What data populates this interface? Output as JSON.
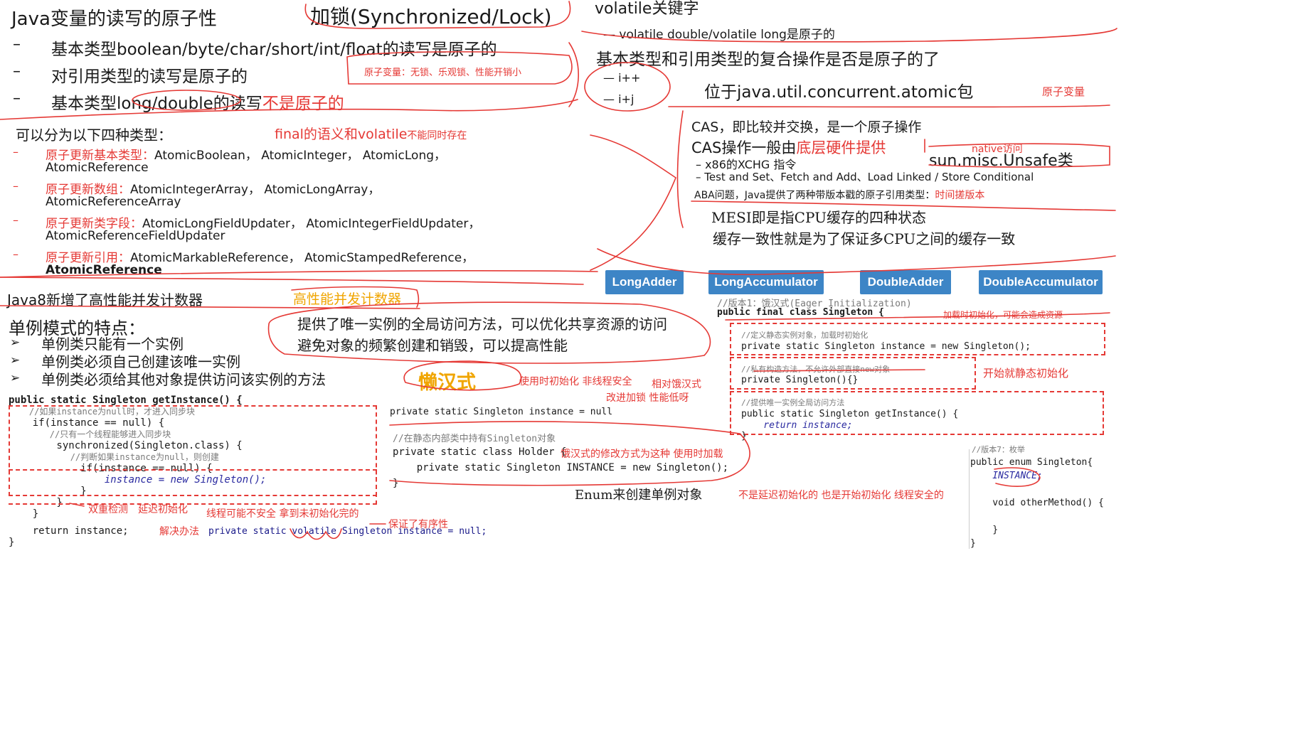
{
  "colors": {
    "red": "#e53935",
    "orange": "#f0a500",
    "badge": "#3d85c6"
  },
  "atomic_rw": {
    "title": "Java变量的读写的原子性",
    "items": [
      "基本类型boolean/byte/char/short/int/float的读写是原子的",
      "对引用类型的读写是原子的",
      "基本类型long/double的读写"
    ],
    "not_atomic": "不是原子的",
    "dash": "–"
  },
  "lock": {
    "title": "加锁(Synchronized/Lock)",
    "note": "原子变量：无锁、乐观锁、性能开销小"
  },
  "volatile_sec": {
    "title": "volatile关键字",
    "line1": "— volatile double/volatile long是原子的",
    "line2": "基本类型和引用类型的复合操作是否是原子的了",
    "ops": [
      "— i++",
      "— i+j"
    ],
    "pkg": "位于java.util.concurrent.atomic包",
    "pkg_note": "原子变量"
  },
  "four_types": {
    "title": "可以分为以下四种类型：",
    "note": "final的语义和volatile",
    "note2": "不能同时存在",
    "rows": [
      {
        "label": "原子更新基本类型：",
        "text": "AtomicBoolean， AtomicInteger， AtomicLong，",
        "line2": "AtomicReference"
      },
      {
        "label": "原子更新数组：",
        "text": "AtomicIntegerArray， AtomicLongArray，",
        "line2": "AtomicReferenceArray"
      },
      {
        "label": "原子更新类字段：",
        "text": "AtomicLongFieldUpdater， AtomicIntegerFieldUpdater，",
        "line2": "AtomicReferenceFieldUpdater"
      },
      {
        "label": "原子更新引用：",
        "text": "AtomicMarkableReference， AtomicStampedReference，",
        "line2": "AtomicReference"
      }
    ]
  },
  "cas": {
    "line1": "CAS，即比较并交换，是一个原子操作",
    "line2a": "CAS操作一般由",
    "line2b": "底层硬件提供",
    "native_note": "native访问",
    "unsafe": "sun.misc.Unsafe类",
    "sub1": "– x86的XCHG 指令",
    "sub2": "– Test and Set、Fetch and Add、Load Linked / Store Conditional",
    "aba": "ABA问题，Java提供了两种带版本戳的原子引用类型：",
    "aba_note": "时间搓版本"
  },
  "mesi": {
    "line1": "MESI即是指CPU缓存的四种状态",
    "line2": "缓存一致性就是为了保证多CPU之间的缓存一致"
  },
  "adders": [
    "LongAdder",
    "LongAccumulator",
    "DoubleAdder",
    "DoubleAccumulator"
  ],
  "java8": {
    "title": "Java8新增了高性能并发计数器",
    "note": "高性能并发计数器"
  },
  "singleton": {
    "title": "单例模式的特点：",
    "items": [
      "单例类只能有一个实例",
      "单例类必须自己创建该唯一实例",
      "单例类必须给其他对象提供访问该实例的方法"
    ],
    "benefit1": "提供了唯一实例的全局访问方法，可以优化共享资源的访问",
    "benefit2": "避免对象的频繁创建和销毁，可以提高性能",
    "lazy": "懒汉式",
    "lazy_note": "使用时初始化 非线程安全",
    "lazy_note2": "相对饿汉式",
    "lazy_note3": "改进加锁 性能低呀"
  },
  "dcl": {
    "lines": [
      "public static Singleton getInstance() {",
      "    //如果instance为null时，才进入同步块",
      "    if(instance == null) {",
      "        //只有一个线程能够进入同步块",
      "        synchronized(Singleton.class) {",
      "            //判断如果instance为null，则创建",
      "            if(instance == null) {",
      "                instance = new Singleton();",
      "            }",
      "        }",
      "    }",
      "    return instance;",
      "}"
    ],
    "note1": "双重检测　延迟初始化",
    "note2": "线程可能不安全 拿到未初始化完的",
    "fix_label": "解决办法",
    "fix_code": "private static volatile Singleton instance = null;",
    "fix_note": "保证了有序性"
  },
  "holder": {
    "line0": "private static Singleton instance = null",
    "comment": "//在静态内部类中持有Singleton对象",
    "line1": "private static class Holder {",
    "line2": "    private static Singleton INSTANCE = new Singleton();",
    "line3": "}",
    "note": "饿汉式的修改方式为这种 使用时加载"
  },
  "eager": {
    "comment0": "//版本1：饿汉式(Eager Initialization)",
    "line0": "public final class Singleton {",
    "note0": "加载时初始化，可能会造成资源",
    "comment1": "//定义静态实例对象，加载时初始化",
    "line1": "private static Singleton instance = new Singleton();",
    "comment2": "//私有构造方法，不允许外部直接new对象",
    "line2": "private Singleton(){}",
    "note2": "开始就静态初始化",
    "comment3": "//提供唯一实例全局访问方法",
    "line3": "public static Singleton getInstance() {",
    "line4": "    return instance;",
    "line5": "}"
  },
  "enum_sec": {
    "title": "Enum来创建单例对象",
    "note": "不是延迟初始化的 也是开始初始化 线程安全的",
    "comment": "//版本7：枚举",
    "lines": [
      "public enum Singleton{",
      "    INSTANCE;",
      "",
      "    void otherMethod() {",
      "",
      "    }",
      "}"
    ]
  }
}
